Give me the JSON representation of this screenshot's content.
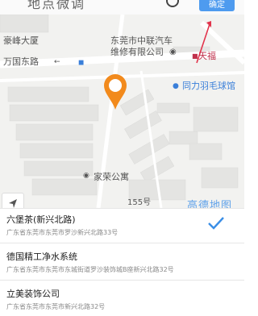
{
  "topbar": {
    "title": "地点微调",
    "confirm_label": "确定"
  },
  "map": {
    "labels": {
      "haoyi": "豪峰大厦",
      "wanguo": "万国东路",
      "zhonglian": "东莞市中联汽车",
      "zhonglian2": "维修有限公司",
      "tianfu": "天福",
      "badminton": "同力羽毛球馆",
      "apartment": "家荣公寓",
      "num": "155号",
      "watermark": "高德地图"
    }
  },
  "results": [
    {
      "name": "六堡茶(新兴北路)",
      "address": "广东省东莞市东莞市罗沙新兴北路33号",
      "selected": true
    },
    {
      "name": "德国精工净水系统",
      "address": "广东省东莞市东莞市东城街道罗沙装饰城B座新兴北路32号",
      "selected": false
    },
    {
      "name": "立美装饰公司",
      "address": "广东省东莞市东莞市新兴北路32号",
      "selected": false
    }
  ],
  "colors": {
    "accent": "#3a8ee6",
    "pin": "#f28a1c"
  }
}
